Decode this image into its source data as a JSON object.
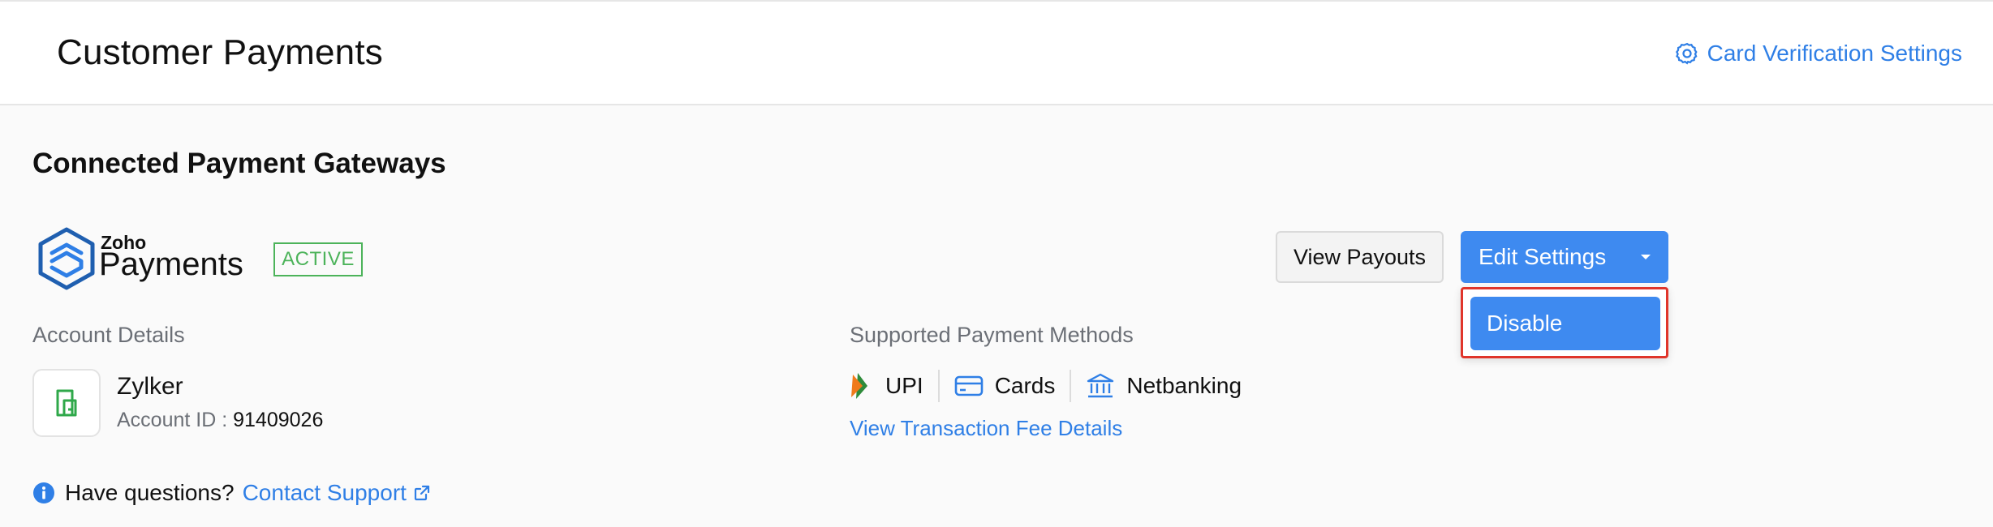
{
  "header": {
    "title": "Customer Payments",
    "verification_link": "Card Verification Settings"
  },
  "section": {
    "title": "Connected Payment Gateways"
  },
  "gateway": {
    "brand_small": "Zoho",
    "brand_name": "Payments",
    "status": "ACTIVE",
    "view_payouts_label": "View Payouts",
    "edit_settings_label": "Edit Settings",
    "dropdown": {
      "items": [
        "Disable"
      ]
    }
  },
  "account": {
    "label": "Account Details",
    "name": "Zylker",
    "id_label": "Account ID :",
    "id_value": "91409026"
  },
  "methods": {
    "label": "Supported Payment Methods",
    "items": [
      "UPI",
      "Cards",
      "Netbanking"
    ],
    "fee_link": "View Transaction Fee Details"
  },
  "help": {
    "question": "Have questions?",
    "link": "Contact Support"
  },
  "colors": {
    "accent": "#3e8af0",
    "link": "#2f7fe6",
    "active_green": "#4cb35a",
    "highlight_red": "#e0352b"
  }
}
